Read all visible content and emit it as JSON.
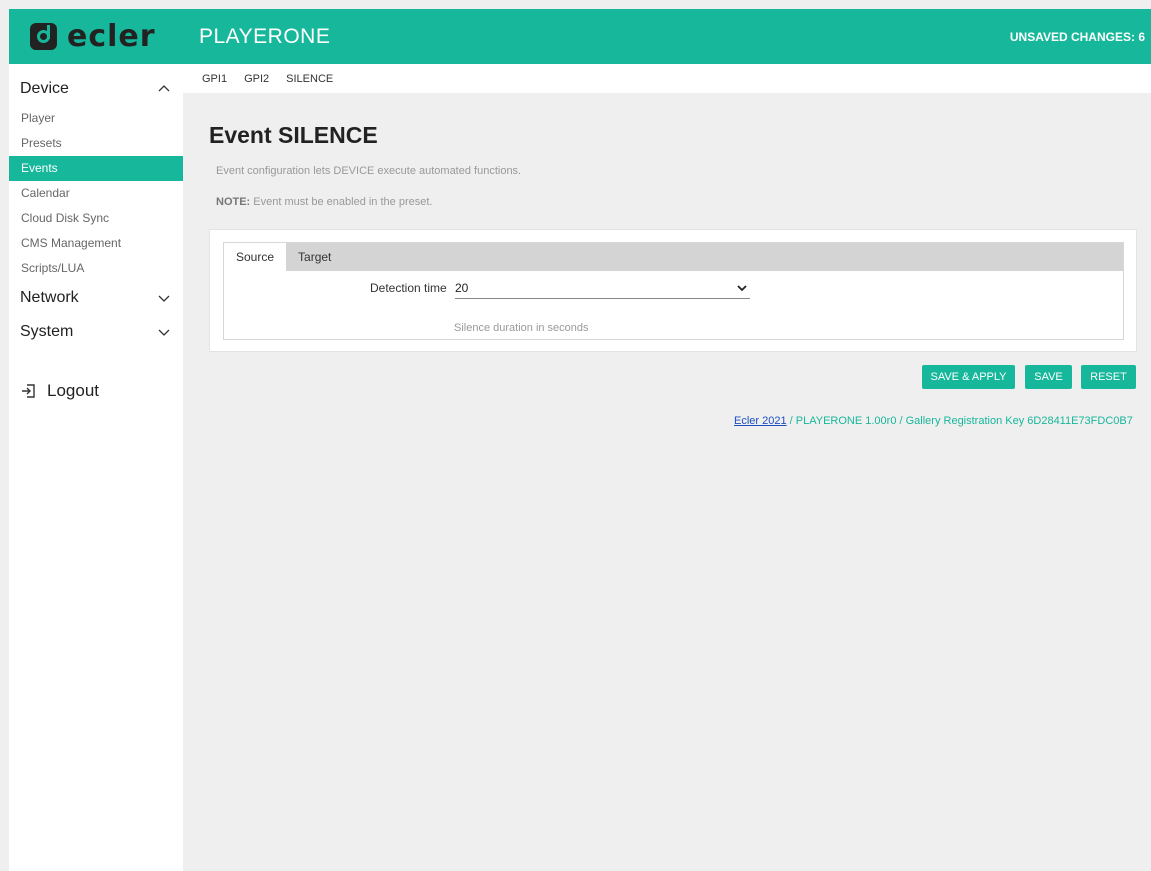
{
  "header": {
    "brand": "ecler",
    "title": "PLAYERONE",
    "unsaved": "UNSAVED CHANGES: 6",
    "color": "#17b79b"
  },
  "sidebar": {
    "device": {
      "label": "Device",
      "items": [
        "Player",
        "Presets",
        "Events",
        "Calendar",
        "Cloud Disk Sync",
        "CMS Management",
        "Scripts/LUA"
      ],
      "active": "Events"
    },
    "network": "Network",
    "system": "System",
    "logout": "Logout"
  },
  "topnav": [
    "GPI1",
    "GPI2",
    "SILENCE"
  ],
  "main": {
    "title": "Event SILENCE",
    "description": "Event configuration lets DEVICE execute automated functions.",
    "note_label": "NOTE:",
    "note_text": " Event must be enabled in the preset.",
    "tabs": [
      "Source",
      "Target"
    ],
    "detection_label": "Detection time",
    "detection_value": "20",
    "hint": "Silence duration in seconds"
  },
  "buttons": {
    "save_apply": "SAVE & APPLY",
    "save": "SAVE",
    "reset": "RESET"
  },
  "footer": {
    "link": "Ecler 2021",
    "text": " / PLAYERONE 1.00r0 / Gallery Registration Key 6D28411E73FDC0B7"
  }
}
